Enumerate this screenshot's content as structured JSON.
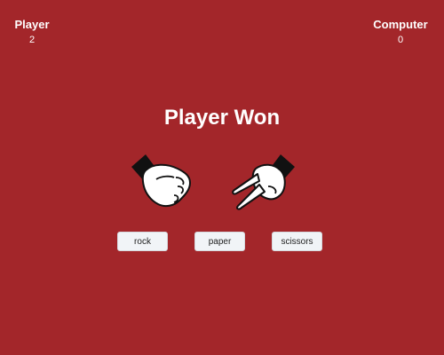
{
  "score": {
    "player_label": "Player",
    "player_value": "2",
    "computer_label": "Computer",
    "computer_value": "0"
  },
  "result": "Player Won",
  "hands": {
    "player": "rock-fist-icon",
    "computer": "scissors-hand-icon"
  },
  "buttons": {
    "rock": "rock",
    "paper": "paper",
    "scissors": "scissors"
  },
  "colors": {
    "background": "#a3262a",
    "text": "#ffffff",
    "button_bg": "#f1f4f7"
  }
}
